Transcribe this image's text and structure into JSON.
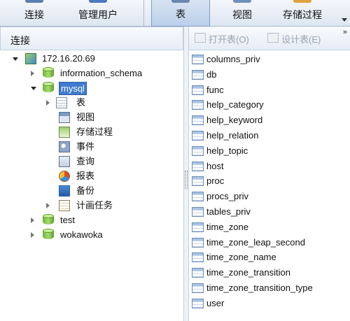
{
  "toolbar": {
    "buttons": [
      {
        "label": "连接",
        "icon": "connection-icon"
      },
      {
        "label": "管理用户",
        "icon": "users-icon"
      },
      {
        "label": "表",
        "icon": "table-icon",
        "active": true
      },
      {
        "label": "视图",
        "icon": "view-icon"
      },
      {
        "label": "存储过程",
        "icon": "procedure-icon"
      }
    ],
    "accent": "#3f7bd0"
  },
  "left_panel": {
    "title": "连接",
    "tree": {
      "server": "172.16.20.69",
      "databases": [
        {
          "name": "information_schema",
          "expanded": false
        },
        {
          "name": "mysql",
          "expanded": true,
          "selected": true,
          "children": [
            "表",
            "视图",
            "存储过程",
            "事件",
            "查询",
            "报表",
            "备份",
            "计画任务"
          ]
        },
        {
          "name": "test",
          "expanded": false
        },
        {
          "name": "wokawoka",
          "expanded": false
        }
      ]
    }
  },
  "right_panel": {
    "toolbar": {
      "open_table": "打开表(O)",
      "design_table": "设计表(E)",
      "more": "»"
    },
    "tables": [
      "columns_priv",
      "db",
      "func",
      "help_category",
      "help_keyword",
      "help_relation",
      "help_topic",
      "host",
      "proc",
      "procs_priv",
      "tables_priv",
      "time_zone",
      "time_zone_leap_second",
      "time_zone_name",
      "time_zone_transition",
      "time_zone_transition_type",
      "user"
    ]
  }
}
